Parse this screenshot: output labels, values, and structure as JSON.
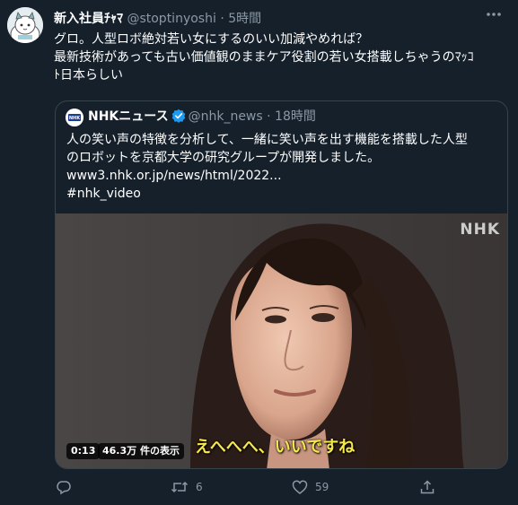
{
  "tweet": {
    "author_name": "新入社員ﾁｬﾏ",
    "handle": "@stoptinyoshi",
    "separator": "·",
    "time": "5時間",
    "text_lines": [
      "グロ。人型ロボ絶対若い女にするのいい加減やめれば？",
      "最新技術があっても古い価値観のままケア役割の若い女搭載しちゃうのﾏｯｺ",
      "ﾄ日本らしい"
    ]
  },
  "quote": {
    "author_name": "NHKニュース",
    "handle": "@nhk_news",
    "separator": "·",
    "time": "18時間",
    "avatar_text": "NHK NEWS",
    "text_lines": [
      "人の笑い声の特徴を分析して、一緒に笑い声を出す機能を搭載した人型",
      "のロボットを京都大学の研究グループが開発しました。"
    ],
    "link": "www3.nhk.or.jp/news/html/2022...",
    "hashtag": "#nhk_video",
    "media": {
      "watermark": "NHK",
      "duration": "0:13",
      "views": "46.3万 件の表示",
      "subtitle": "えへへへ、いいですね"
    }
  },
  "actions": {
    "reply_count": "",
    "retweet_count": "6",
    "like_count": "59"
  },
  "colors": {
    "background": "#15202b",
    "secondary_text": "#8b98a5",
    "border": "#38444d",
    "verified": "#1d9bf0",
    "subtitle": "#f5e84a"
  }
}
